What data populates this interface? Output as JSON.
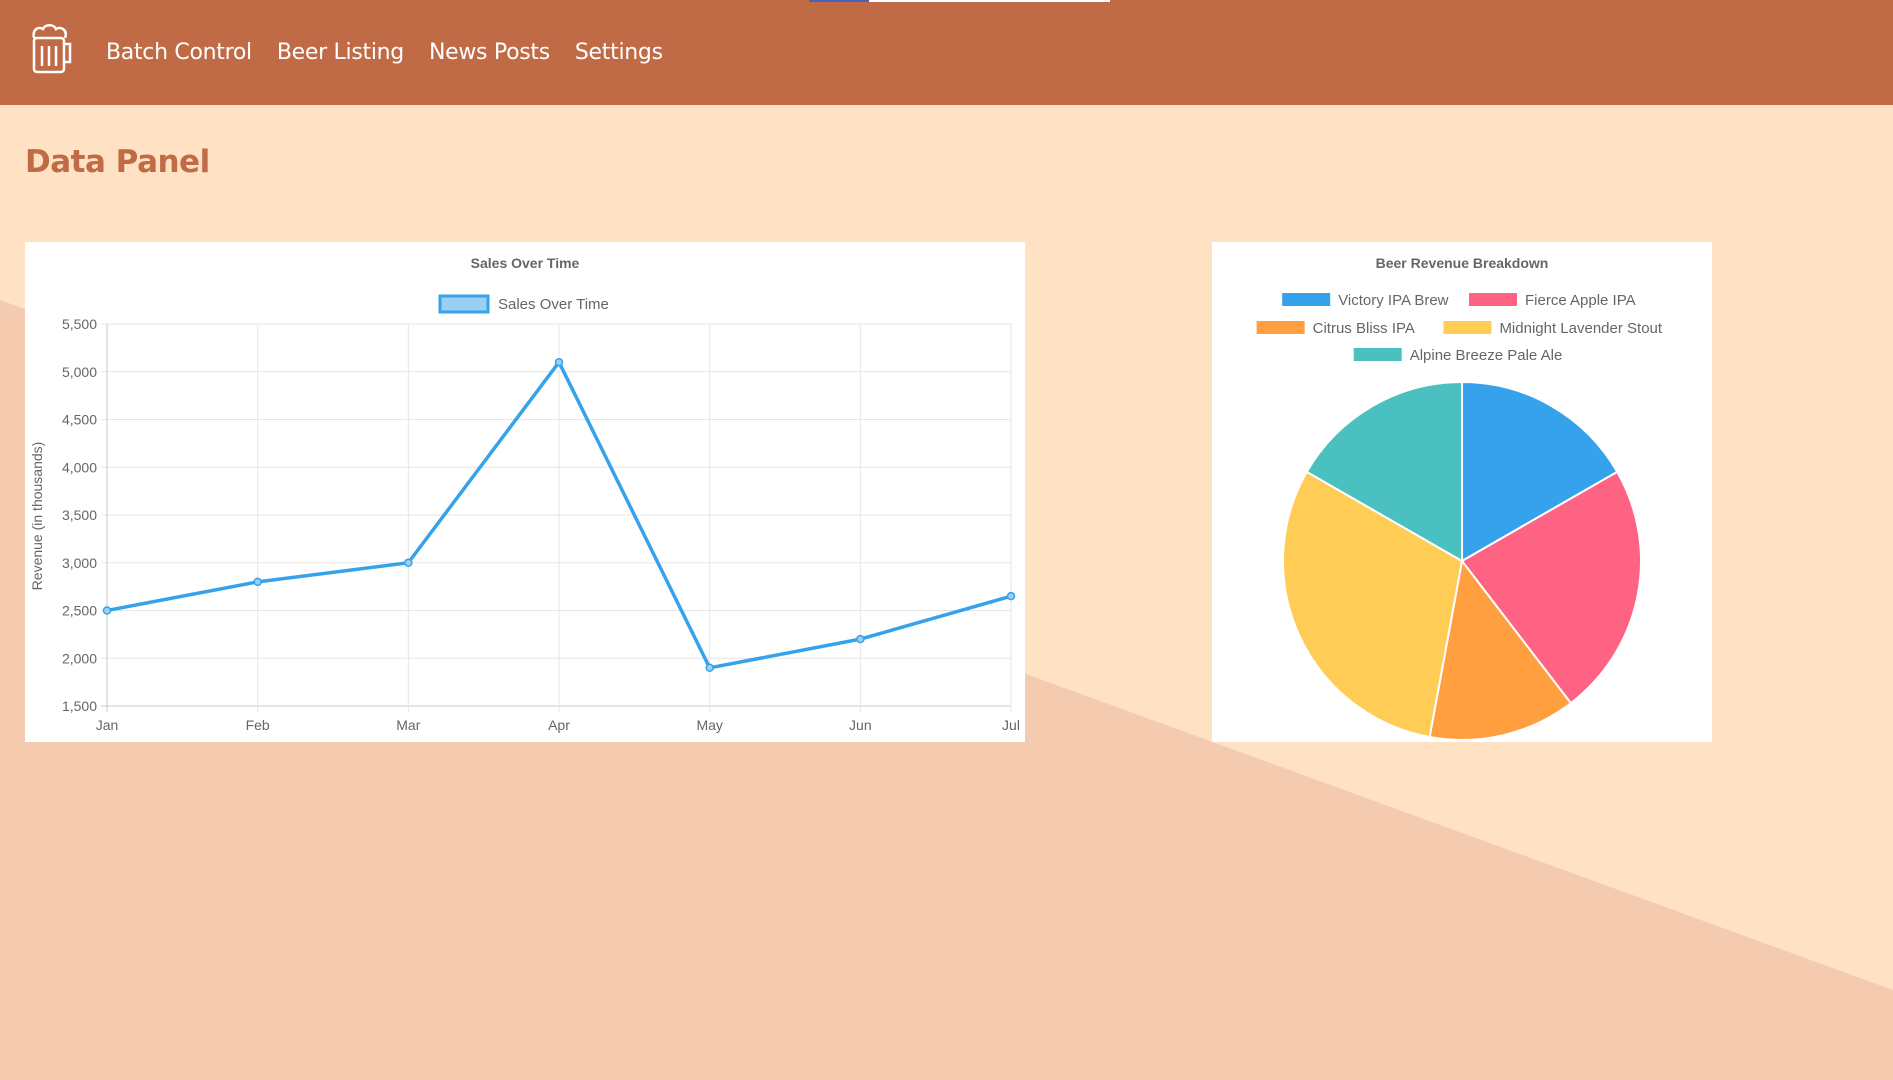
{
  "nav": {
    "logo_icon": "beer-mug-icon",
    "items": [
      "Batch Control",
      "Beer Listing",
      "News Posts",
      "Settings"
    ]
  },
  "page": {
    "title": "Data Panel"
  },
  "colors": {
    "header": "#c06b45",
    "background": "#ffe1c4",
    "background_shape": "#f5cbb0",
    "title": "#c06b45",
    "line": "#36a2eb"
  },
  "chart_data": [
    {
      "type": "line",
      "title": "Sales Over Time",
      "legend": "top",
      "series": [
        {
          "name": "Sales Over Time",
          "values": [
            2500,
            2800,
            3000,
            5100,
            1900,
            2200,
            2650
          ]
        }
      ],
      "categories": [
        "Jan",
        "Feb",
        "Mar",
        "Apr",
        "May",
        "Jun",
        "Jul"
      ],
      "xlabel": "",
      "ylabel": "Revenue (in thousands)",
      "ylim": [
        1500,
        5500
      ],
      "yticks": [
        1500,
        2000,
        2500,
        3000,
        3500,
        4000,
        4500,
        5000,
        5500
      ],
      "ytick_labels": [
        "1,500",
        "2,000",
        "2,500",
        "3,000",
        "3,500",
        "4,000",
        "4,500",
        "5,000",
        "5,500"
      ],
      "grid": true
    },
    {
      "type": "pie",
      "title": "Beer Revenue Breakdown",
      "legend": "top",
      "labels": [
        "Victory IPA Brew",
        "Fierce Apple IPA",
        "Citrus Bliss IPA",
        "Midnight Lavender Stout",
        "Alpine Breeze Pale Ale"
      ],
      "values": [
        16.7,
        22.9,
        13.3,
        30.4,
        16.7
      ],
      "colors": [
        "#36a2eb",
        "#ff6384",
        "#ff9f40",
        "#ffcd56",
        "#4bc0c0"
      ]
    }
  ]
}
